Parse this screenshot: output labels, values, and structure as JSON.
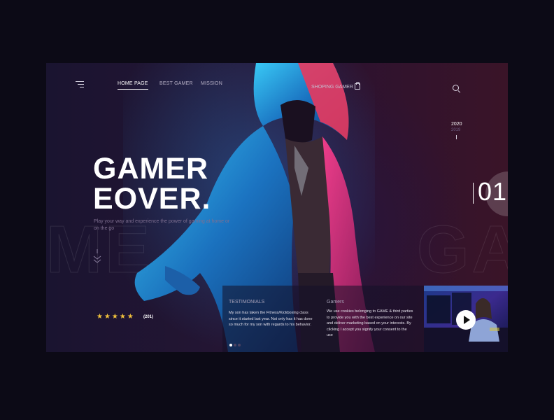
{
  "nav": {
    "items": [
      {
        "label": "HOME PAGE",
        "active": true
      },
      {
        "label": "BEST GAMER",
        "active": false
      },
      {
        "label": "MISSION",
        "active": false
      }
    ],
    "shop_label": "SHOPING GAMER"
  },
  "years": {
    "current": "2020",
    "previous": "2019"
  },
  "slide": {
    "number": "01"
  },
  "hero": {
    "title_line1": "GAMER",
    "title_line2": "EOVER.",
    "subtitle": "Play your way and experience the power of gaming at home or on the go",
    "background_word_left": "ME",
    "background_word_right": "GA"
  },
  "rating": {
    "stars": 5,
    "stars_text": "★★★★★",
    "count": "(201)"
  },
  "testimonials": {
    "title": "TESTIMONIALS",
    "text": "My son has taken the Fitness/Kickboxing class since it started last year.  Not only has it has done so much for my son with regards to his behavior."
  },
  "gamers": {
    "title": "Gamers",
    "text": "We use cookies belonging to GAME & third parties to provide you with the best experience on our site and deliver marketing based on your interests. By clicking I accept you signify your consent to the use"
  },
  "colors": {
    "background": "#0c0a16",
    "accent_blue": "#2fb8ff",
    "accent_pink": "#ff2d86",
    "star": "#f2c23c"
  },
  "icons": [
    "menu-icon",
    "shopping-bag-icon",
    "search-icon",
    "scroll-down-icon",
    "play-icon"
  ]
}
